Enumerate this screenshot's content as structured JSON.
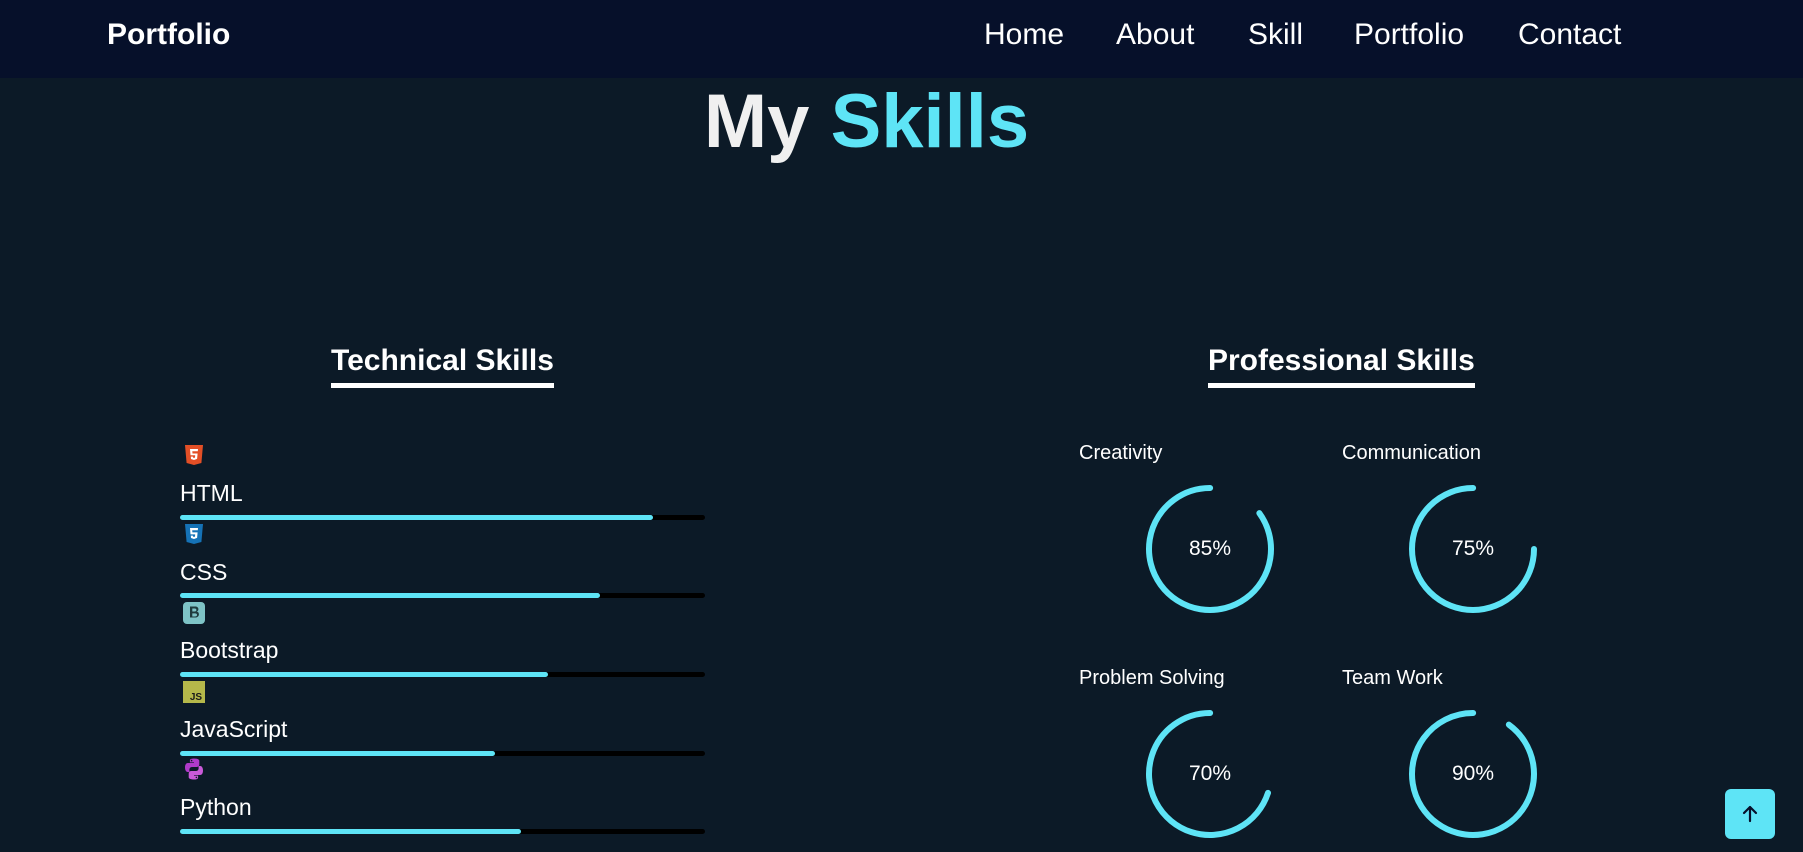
{
  "nav": {
    "brand": "Portfolio",
    "links": [
      "Home",
      "About",
      "Skill",
      "Portfolio",
      "Contact"
    ]
  },
  "hero": {
    "title_plain": "My",
    "title_accent": "Skills"
  },
  "technical": {
    "heading": "Technical Skills",
    "skills": [
      {
        "name": "HTML",
        "icon": "html5-icon",
        "level": 0.9
      },
      {
        "name": "CSS",
        "icon": "css3-icon",
        "level": 0.8
      },
      {
        "name": "Bootstrap",
        "icon": "bootstrap-icon",
        "level": 0.7
      },
      {
        "name": "JavaScript",
        "icon": "javascript-icon",
        "level": 0.6
      },
      {
        "name": "Python",
        "icon": "python-icon",
        "level": 0.65
      }
    ]
  },
  "professional": {
    "heading": "Professional Skills",
    "skills": [
      {
        "name": "Creativity",
        "percent": "85%",
        "level": 0.85
      },
      {
        "name": "Communication",
        "percent": "75%",
        "level": 0.75
      },
      {
        "name": "Problem Solving",
        "percent": "70%",
        "level": 0.7
      },
      {
        "name": "Team Work",
        "percent": "90%",
        "level": 0.9
      }
    ]
  },
  "back_to_top": {
    "icon": "arrow-up-icon"
  },
  "colors": {
    "background": "#0c1a27",
    "navbar": "#06102a",
    "accent": "#5ee4f6",
    "track": "#000000",
    "html": "#e34f26",
    "css": "#1572b6",
    "bootstrap": "#7ec3c6",
    "javascript": "#b5b84a",
    "python": "#b03ac9"
  }
}
